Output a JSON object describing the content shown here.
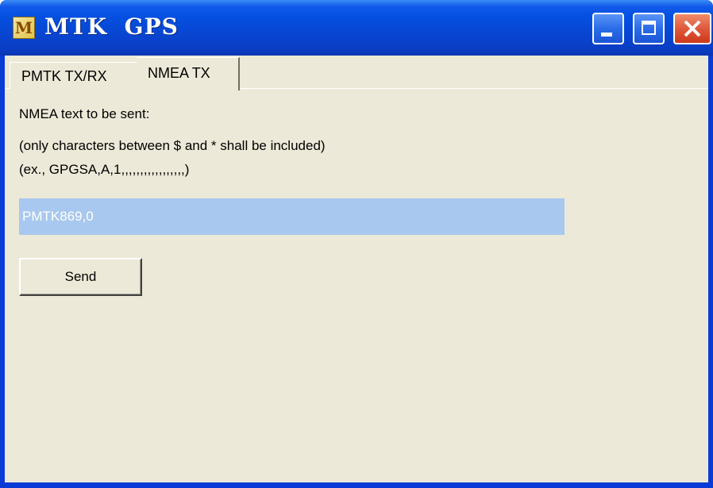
{
  "window": {
    "icon_letter": "M",
    "title": "MTK  GPS",
    "controls": {
      "minimize": "minimize-icon",
      "maximize": "maximize-icon",
      "close": "close-icon"
    }
  },
  "tabs": [
    {
      "label": "PMTK TX/RX",
      "active": false
    },
    {
      "label": "NMEA TX",
      "active": true
    }
  ],
  "panel": {
    "instruction": "NMEA text to be sent:",
    "note_line1": "(only characters between $ and * shall be included)",
    "note_line2": "(ex., GPGSA,A,1,,,,,,,,,,,,,,,,,)",
    "input_value": "PMTK869,0",
    "send_label": "Send"
  },
  "colors": {
    "titlebar": "#0550e0",
    "client_bg": "#ece9d8",
    "input_highlight": "#a8c8ef",
    "close_button": "#e0583a"
  }
}
